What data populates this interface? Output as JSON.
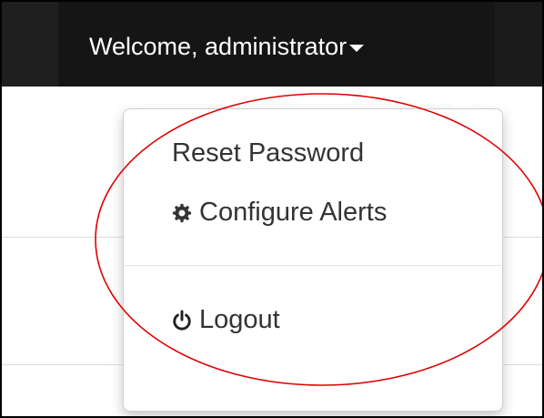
{
  "navbar": {
    "welcome_label": "Welcome, administrator"
  },
  "dropdown": {
    "items": [
      {
        "label": "Reset Password",
        "icon": ""
      },
      {
        "label": "Configure Alerts",
        "icon": "gear-icon"
      },
      {
        "label": "Logout",
        "icon": "power-icon"
      }
    ]
  },
  "colors": {
    "navbar_bg": "#151515",
    "annotation": "#e00000",
    "menu_text": "#333333"
  }
}
